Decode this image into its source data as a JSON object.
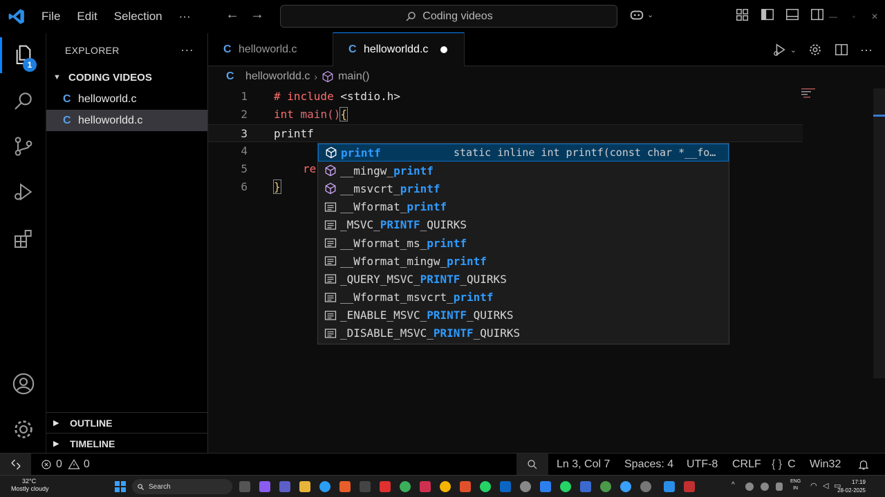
{
  "menu": [
    "File",
    "Edit",
    "Selection",
    "···"
  ],
  "command_center": {
    "text": "Coding videos"
  },
  "sidebar": {
    "title": "EXPLORER",
    "folder": "CODING VIDEOS",
    "files": [
      {
        "name": "helloworld.c",
        "selected": false
      },
      {
        "name": "helloworldd.c",
        "selected": true
      }
    ],
    "outline": "OUTLINE",
    "timeline": "TIMELINE",
    "explorer_badge": "1"
  },
  "tabs": [
    {
      "label": "helloworld.c",
      "active": false
    },
    {
      "label": "helloworldd.c",
      "active": true,
      "dirty": true
    }
  ],
  "breadcrumb": {
    "file": "helloworldd.c",
    "symbol": "main()"
  },
  "code": {
    "line_numbers": [
      "1",
      "2",
      "3",
      "4",
      "5",
      "6"
    ],
    "line1": {
      "hash": "# ",
      "kw": "include",
      "rest": " <stdio.h>"
    },
    "line2": {
      "kw": "int",
      "fn": " main()",
      "brace": "{"
    },
    "line3": "printf",
    "line4": "",
    "line5": "re",
    "line6": "}"
  },
  "suggest": {
    "detail": "static inline int printf(const char *__fo…",
    "items": [
      {
        "icon": "cube",
        "pre": "",
        "match": "printf",
        "post": "",
        "focused": true
      },
      {
        "icon": "cube",
        "pre": "__mingw_",
        "match": "printf",
        "post": ""
      },
      {
        "icon": "cube",
        "pre": "__msvcrt_",
        "match": "printf",
        "post": ""
      },
      {
        "icon": "text",
        "pre": "__Wformat_",
        "match": "printf",
        "post": ""
      },
      {
        "icon": "text",
        "pre": "_MSVC_",
        "match": "PRINTF",
        "post": "_QUIRKS"
      },
      {
        "icon": "text",
        "pre": "__Wformat_ms_",
        "match": "printf",
        "post": ""
      },
      {
        "icon": "text",
        "pre": "__Wformat_mingw_",
        "match": "printf",
        "post": ""
      },
      {
        "icon": "text",
        "pre": "_QUERY_MSVC_",
        "match": "PRINTF",
        "post": "_QUIRKS"
      },
      {
        "icon": "text",
        "pre": "__Wformat_msvcrt_",
        "match": "printf",
        "post": ""
      },
      {
        "icon": "text",
        "pre": "_ENABLE_MSVC_",
        "match": "PRINTF",
        "post": "_QUIRKS"
      },
      {
        "icon": "text",
        "pre": "_DISABLE_MSVC_",
        "match": "PRINTF",
        "post": "_QUIRKS"
      }
    ]
  },
  "status": {
    "errors": "0",
    "warnings": "0",
    "position": "Ln 3, Col 7",
    "spaces": "Spaces: 4",
    "encoding": "UTF-8",
    "eol": "CRLF",
    "language": "C",
    "platform": "Win32"
  },
  "taskbar": {
    "temp": "32°C",
    "weather": "Mostly cloudy",
    "search": "Search",
    "lang1": "ENG",
    "lang2": "IN",
    "time": "17:19",
    "date": "28-02-2025"
  },
  "colors": {
    "accent": "#0a84ff",
    "keyword": "#ff6b6b",
    "match": "#2f9bff",
    "selected_item": "#04395e"
  }
}
